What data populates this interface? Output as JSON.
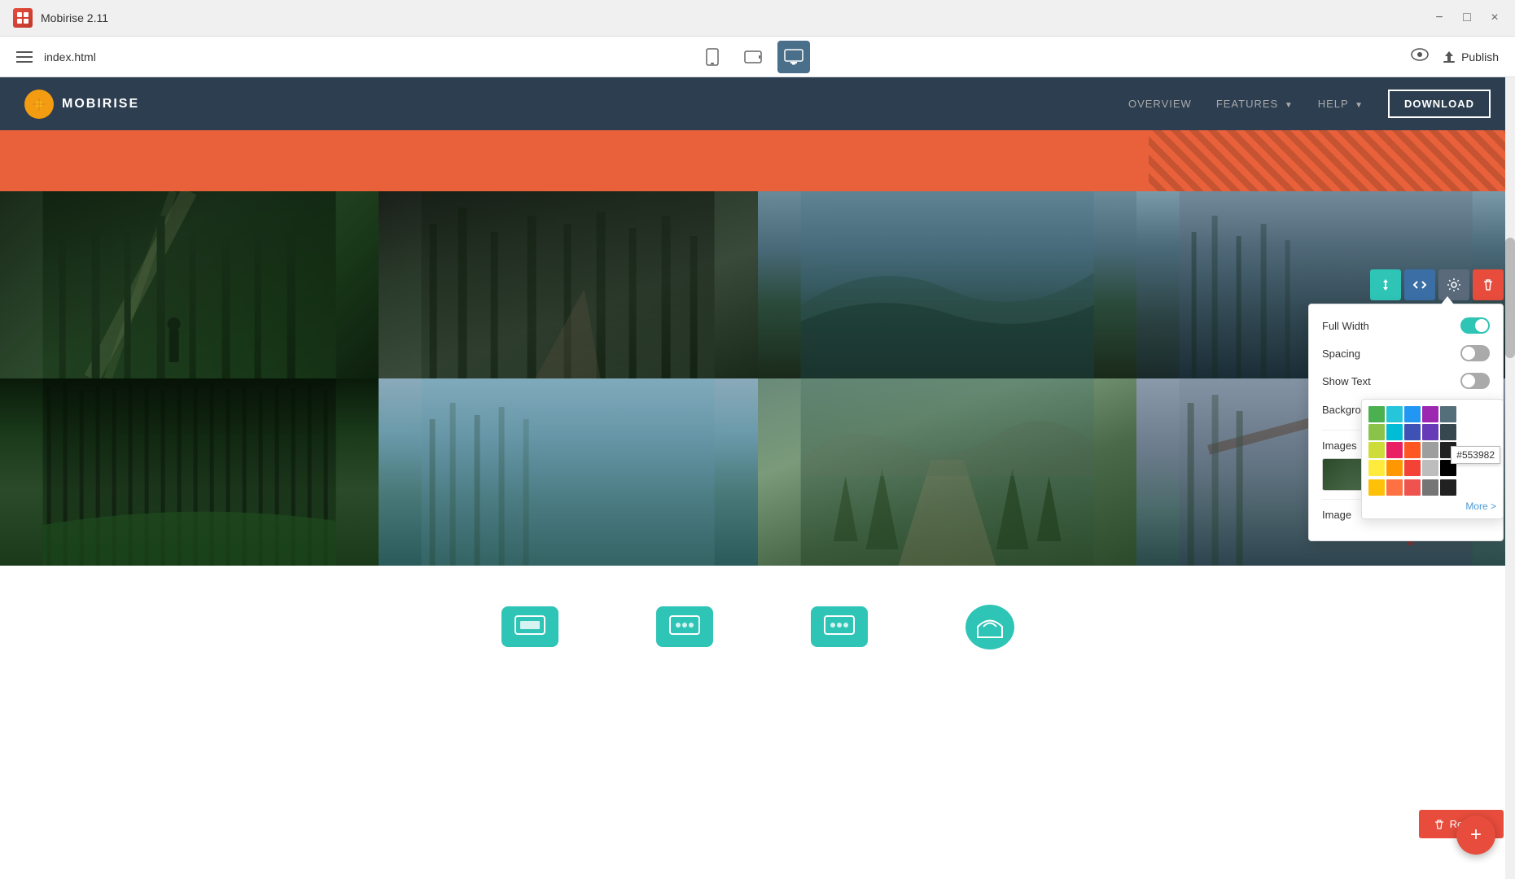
{
  "titlebar": {
    "app_name": "Mobirise 2.11",
    "minimize": "−",
    "maximize": "□",
    "close": "×"
  },
  "toolbar": {
    "menu_icon": "☰",
    "filename": "index.html",
    "device_mobile": "📱",
    "device_tablet": "📲",
    "device_desktop": "🖥",
    "preview_icon": "👁",
    "publish_icon": "☁",
    "publish_label": "Publish"
  },
  "site": {
    "logo_text": "MOBIRISE",
    "nav": {
      "overview": "OVERVIEW",
      "features": "FEATURES",
      "help": "HELP",
      "download": "DOWNLOAD"
    }
  },
  "settings_panel": {
    "full_width_label": "Full Width",
    "full_width_on": true,
    "spacing_label": "Spacing",
    "spacing_on": false,
    "show_text_label": "Show Text",
    "show_text_on": false,
    "bg_color_label": "Background Color",
    "images_label": "Images",
    "image_label": "Image"
  },
  "color_picker": {
    "hex_value": "#553982",
    "swatches": [
      "#4caf50",
      "#00bcd4",
      "#2196f3",
      "#9c27b0",
      "#607d8b",
      "#8bc34a",
      "#03a9f4",
      "#3f51b5",
      "#673ab7",
      "#455a64",
      "#cddc39",
      "#00bcd4",
      "#e91e63",
      "#9e9e9e",
      "#37474f",
      "#ffeb3b",
      "#ff9800",
      "#ff5722",
      "#795548",
      "#212121",
      "#ffc107",
      "#ff5722",
      "#f44336",
      "#9e9e9e",
      "#000000"
    ],
    "more_label": "More >"
  },
  "context_toolbar": {
    "reorder_icon": "⇅",
    "code_icon": "</>",
    "settings_icon": "⚙",
    "delete_icon": "🗑"
  },
  "remove_btn": {
    "icon": "🗑",
    "label": "Remove"
  },
  "fab": {
    "icon": "+"
  }
}
